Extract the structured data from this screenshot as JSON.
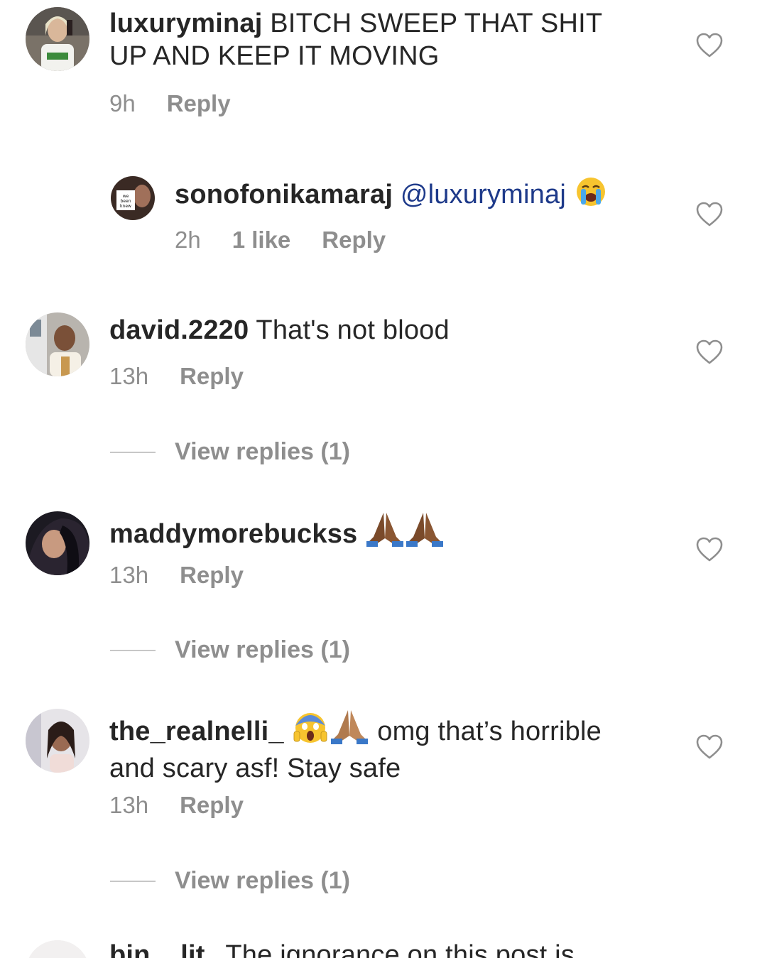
{
  "comments": [
    {
      "username": "luxuryminaj",
      "text_line1": "BITCH SWEEP THAT SHIT",
      "text_line2": "UP AND KEEP IT MOVING",
      "time": "9h",
      "reply": "Reply",
      "avatar": "profile-photo"
    },
    {
      "username": "sonofonikamaraj",
      "mention": "@luxuryminaj",
      "emoji": "loudly-crying-face",
      "time": "2h",
      "likes": "1 like",
      "reply": "Reply",
      "avatar": "profile-photo"
    },
    {
      "username": "david.2220",
      "text": "That's not blood",
      "time": "13h",
      "reply": "Reply",
      "view_replies": "View replies (1)",
      "avatar": "profile-photo"
    },
    {
      "username": "maddymorebuckss",
      "emoji": "folded-hands x2",
      "time": "13h",
      "reply": "Reply",
      "view_replies": "View replies (1)",
      "avatar": "profile-photo"
    },
    {
      "username": "the_realnelli_",
      "text_line1": "omg that’s horrible",
      "text_line2": "and scary asf! Stay safe",
      "emoji": "screaming-face, folded-hands",
      "time": "13h",
      "reply": "Reply",
      "view_replies": "View replies (1)",
      "avatar": "profile-photo"
    },
    {
      "username": "bin__lit",
      "text": "The ignorance on this post is",
      "avatar": "profile-photo"
    }
  ],
  "colors": {
    "text": "#262626",
    "meta": "#8e8e8e",
    "mention": "#1e3a8a",
    "divider": "#c7c7c7"
  },
  "icons": {
    "like": "heart-outline-icon"
  }
}
